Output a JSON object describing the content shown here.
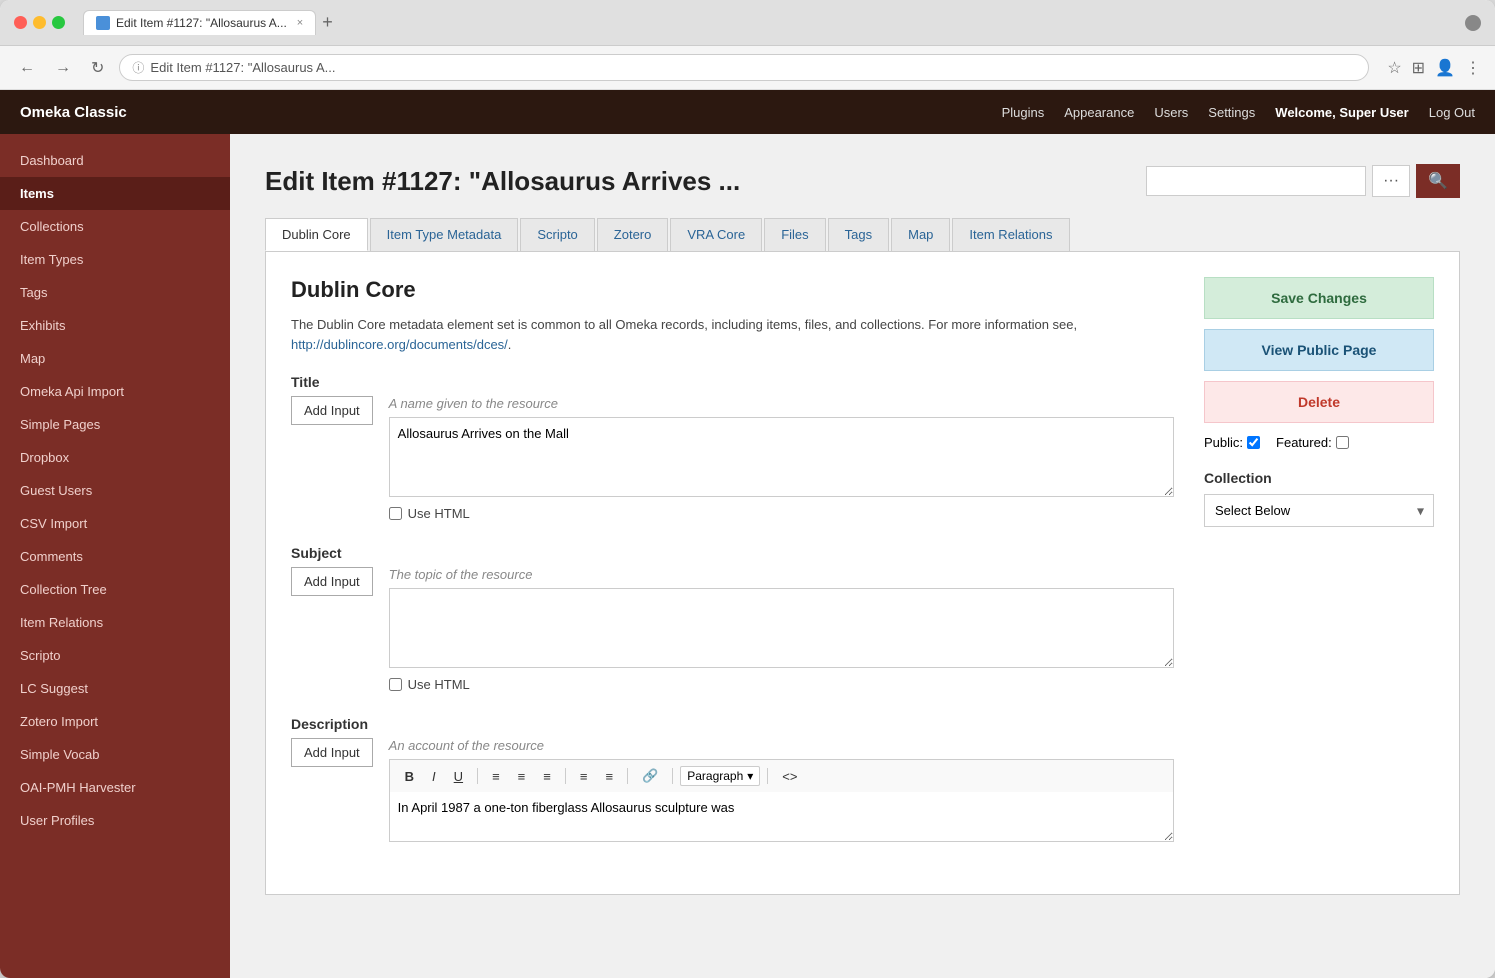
{
  "browser": {
    "tab_title": "Edit Item #1127: \"Allosaurus A...",
    "tab_close": "×",
    "tab_add": "+",
    "back": "←",
    "forward": "→",
    "refresh": "↻",
    "info_icon": "ⓘ",
    "address": "Edit Item #1127: \"Allosaurus A...",
    "star_icon": "☆",
    "ext_icon": "⊞",
    "user_icon": "👤",
    "menu_icon": "⋮"
  },
  "app": {
    "brand": "Omeka Classic",
    "nav": {
      "plugins": "Plugins",
      "appearance": "Appearance",
      "users": "Users",
      "settings": "Settings",
      "welcome_label": "Welcome,",
      "welcome_user": "Super User",
      "logout": "Log Out"
    }
  },
  "sidebar": {
    "items": [
      {
        "id": "dashboard",
        "label": "Dashboard",
        "active": false
      },
      {
        "id": "items",
        "label": "Items",
        "active": true
      },
      {
        "id": "collections",
        "label": "Collections",
        "active": false
      },
      {
        "id": "item-types",
        "label": "Item Types",
        "active": false
      },
      {
        "id": "tags",
        "label": "Tags",
        "active": false
      },
      {
        "id": "exhibits",
        "label": "Exhibits",
        "active": false
      },
      {
        "id": "map",
        "label": "Map",
        "active": false
      },
      {
        "id": "omeka-api-import",
        "label": "Omeka Api Import",
        "active": false
      },
      {
        "id": "simple-pages",
        "label": "Simple Pages",
        "active": false
      },
      {
        "id": "dropbox",
        "label": "Dropbox",
        "active": false
      },
      {
        "id": "guest-users",
        "label": "Guest Users",
        "active": false
      },
      {
        "id": "csv-import",
        "label": "CSV Import",
        "active": false
      },
      {
        "id": "comments",
        "label": "Comments",
        "active": false
      },
      {
        "id": "collection-tree",
        "label": "Collection Tree",
        "active": false
      },
      {
        "id": "item-relations",
        "label": "Item Relations",
        "active": false
      },
      {
        "id": "scripto",
        "label": "Scripto",
        "active": false
      },
      {
        "id": "lc-suggest",
        "label": "LC Suggest",
        "active": false
      },
      {
        "id": "zotero-import",
        "label": "Zotero Import",
        "active": false
      },
      {
        "id": "simple-vocab",
        "label": "Simple Vocab",
        "active": false
      },
      {
        "id": "oai-pmh-harvester",
        "label": "OAI-PMH Harvester",
        "active": false
      },
      {
        "id": "user-profiles",
        "label": "User Profiles",
        "active": false
      }
    ]
  },
  "page": {
    "title": "Edit Item #1127: \"Allosaurus Arrives ...",
    "search_placeholder": "",
    "tabs": [
      {
        "id": "dublin-core",
        "label": "Dublin Core",
        "active": true
      },
      {
        "id": "item-type-metadata",
        "label": "Item Type Metadata",
        "active": false
      },
      {
        "id": "scripto",
        "label": "Scripto",
        "active": false
      },
      {
        "id": "zotero",
        "label": "Zotero",
        "active": false
      },
      {
        "id": "vra-core",
        "label": "VRA Core",
        "active": false
      },
      {
        "id": "files",
        "label": "Files",
        "active": false
      },
      {
        "id": "tags",
        "label": "Tags",
        "active": false
      },
      {
        "id": "map",
        "label": "Map",
        "active": false
      },
      {
        "id": "item-relations",
        "label": "Item Relations",
        "active": false
      }
    ]
  },
  "dublin_core": {
    "section_title": "Dublin Core",
    "description": "The Dublin Core metadata element set is common to all Omeka records, including items, files, and collections. For more information see,",
    "description_link": "http://dublincore.org/documents/dces/",
    "description_link_text": "http://dublincore.org/documents/dces/",
    "fields": {
      "title": {
        "label": "Title",
        "hint": "A name given to the resource",
        "value": "Allosaurus Arrives on the Mall",
        "add_input_label": "Add Input",
        "use_html_label": "Use HTML"
      },
      "subject": {
        "label": "Subject",
        "hint": "The topic of the resource",
        "value": "",
        "add_input_label": "Add Input",
        "use_html_label": "Use HTML"
      },
      "description": {
        "label": "Description",
        "hint": "An account of the resource",
        "value": "In April 1987 a one-ton fiberglass Allosaurus sculpture was",
        "add_input_label": "Add Input",
        "rte_buttons": {
          "bold": "B",
          "italic": "I",
          "underline": "U",
          "align_left": "≡",
          "align_center": "≡",
          "align_right": "≡",
          "list_unordered": "≡",
          "list_ordered": "≡",
          "link": "🔗",
          "paragraph": "Paragraph",
          "dropdown_arrow": "▾",
          "source": "<>"
        }
      }
    }
  },
  "sidebar_right": {
    "save_changes": "Save Changes",
    "view_public_page": "View Public Page",
    "delete": "Delete",
    "public_label": "Public:",
    "public_checked": true,
    "featured_label": "Featured:",
    "featured_checked": false,
    "collection_label": "Collection",
    "collection_select_label": "Select Below",
    "collection_options": [
      "Select Below"
    ]
  }
}
